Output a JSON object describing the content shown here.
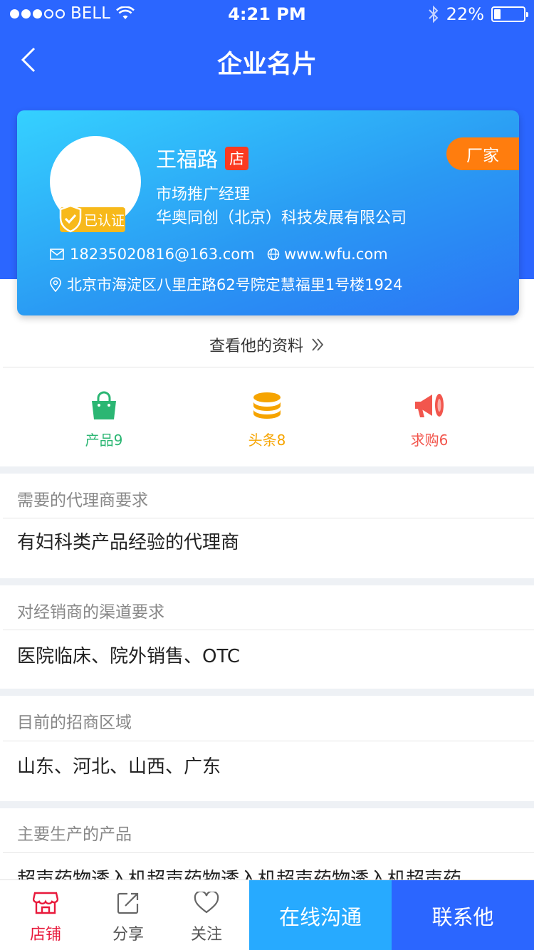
{
  "status_bar": {
    "carrier": "BELL",
    "time": "4:21 PM",
    "battery": "22%"
  },
  "nav": {
    "title": "企业名片"
  },
  "card": {
    "name": "王福路",
    "shop_badge": "店",
    "verified": "已认证",
    "role": "市场推广经理",
    "company": "华奥同创（北京）科技发展有限公司",
    "maker_badge": "厂家",
    "email": "18235020816@163.com",
    "website": "www.wfu.com",
    "address": "北京市海淀区八里庄路62号院定慧福里1号楼1924"
  },
  "profile_link": "查看他的资料",
  "stats": [
    {
      "label": "产品9",
      "color": "#2bb673"
    },
    {
      "label": "头条8",
      "color": "#f6a400"
    },
    {
      "label": "求购6",
      "color": "#f2564d"
    }
  ],
  "sections": [
    {
      "title": "需要的代理商要求",
      "value": "有妇科类产品经验的代理商"
    },
    {
      "title": "对经销商的渠道要求",
      "value": "医院临床、院外销售、OTC"
    },
    {
      "title": "目前的招商区域",
      "value": "山东、河北、山西、广东"
    },
    {
      "title": "主要生产的产品",
      "value": "超声药物透入机超声药物透入机超声药物透入机超声药"
    }
  ],
  "tabbar": {
    "shop": "店铺",
    "share": "分享",
    "follow": "关注",
    "chat_button": "在线沟通",
    "contact_button": "联系他"
  },
  "colors": {
    "primary": "#2b66ff",
    "chat": "#27aaff",
    "active_tab": "#e8193b",
    "maker": "#ff7d0e"
  }
}
